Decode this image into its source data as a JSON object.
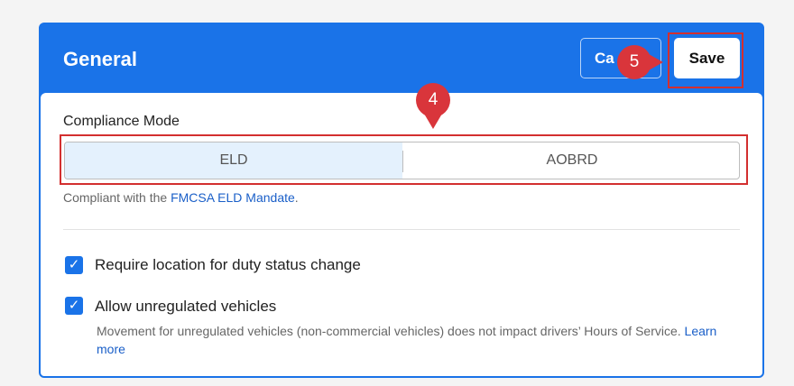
{
  "panel": {
    "title": "General",
    "cancel_label": "Ca",
    "save_label": "Save"
  },
  "annotations": {
    "step_4": "4",
    "step_5": "5"
  },
  "compliance": {
    "label": "Compliance Mode",
    "options": [
      "ELD",
      "AOBRD"
    ],
    "selected": "ELD",
    "helper_prefix": "Compliant with the ",
    "helper_link": "FMCSA ELD Mandate",
    "helper_suffix": "."
  },
  "settings": [
    {
      "label": "Require location for duty status change",
      "checked": true
    },
    {
      "label": "Allow unregulated vehicles",
      "checked": true,
      "description": "Movement for unregulated vehicles (non-commercial vehicles) does not impact drivers’ Hours of Service.",
      "link": "Learn more"
    }
  ],
  "colors": {
    "accent": "#1a73e8",
    "annotation": "#d9353b",
    "selected_segment": "#e4f1fd"
  },
  "icons": {
    "checkbox": "checkmark-icon"
  }
}
